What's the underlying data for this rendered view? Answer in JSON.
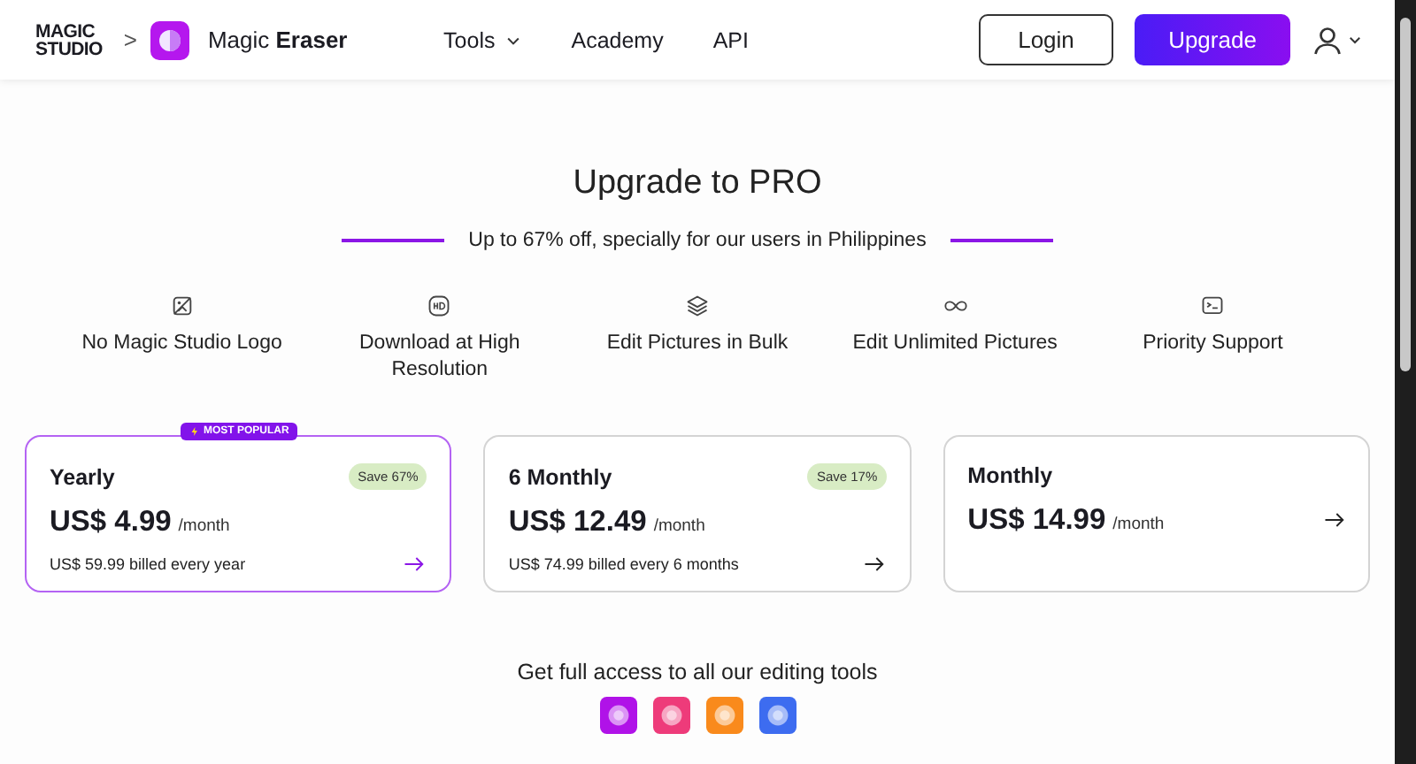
{
  "header": {
    "logo": [
      "MAGIC",
      "STUDIO"
    ],
    "breadcrumb_separator": ">",
    "product": "Magic **Eraser**",
    "nav": [
      {
        "label": "Tools",
        "has_menu": true
      },
      {
        "label": "Academy",
        "has_menu": false
      },
      {
        "label": "API",
        "has_menu": false
      }
    ],
    "buttons": [
      {
        "label": "Login",
        "kind": "outline"
      },
      {
        "label": "Upgrade",
        "kind": "primary"
      }
    ]
  },
  "title": "Upgrade to PRO",
  "offer": "Up to 67% off, specially for our users in Philippines",
  "features": [
    {
      "label": "No Magic Studio Logo",
      "kind": "no-image"
    },
    {
      "label": "Download at High Resolution",
      "kind": "hd"
    },
    {
      "label": "Edit Pictures in Bulk",
      "kind": "layers"
    },
    {
      "label": "Edit Unlimited Pictures",
      "kind": "infinity"
    },
    {
      "label": "Priority Support",
      "kind": "support"
    }
  ],
  "plans": [
    {
      "name": "Yearly",
      "selected": true,
      "badge": "MOST POPULAR",
      "save": "Save 67%",
      "price": "US$ 4.99",
      "unit": "/month",
      "billed": "US$ 59.99 billed every year"
    },
    {
      "name": "6 Monthly",
      "selected": false,
      "save": "Save 17%",
      "price": "US$ 12.49",
      "unit": "/month",
      "billed": "US$ 74.99 billed every 6 months"
    },
    {
      "name": "Monthly",
      "selected": false,
      "price": "US$ 14.99",
      "unit": "/month"
    }
  ],
  "tools_heading": "Get full access to all our editing tools",
  "tools": [
    {
      "color": "#b012e8"
    },
    {
      "color": "#ee3b7a"
    },
    {
      "color": "#f98a1c"
    },
    {
      "color": "#3d6cf0"
    }
  ]
}
